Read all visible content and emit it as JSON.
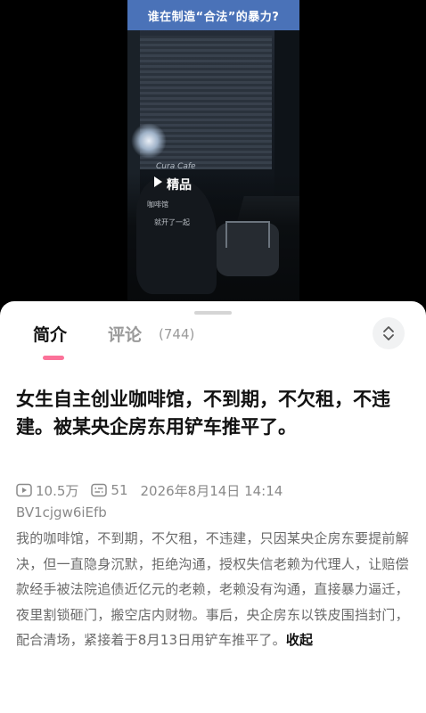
{
  "video": {
    "banner_text": "谁在制造“合法”的暴力?",
    "overlay_sign": "Cura Cafe",
    "overlay_main": "精品",
    "overlay_sub1": "咖啡馆",
    "overlay_sub2": "就开了一起",
    "banner_color": "#4a72b8"
  },
  "tabs": {
    "intro_label": "简介",
    "comments_label": "评论",
    "comments_count": "(744)",
    "accent": "#fb7299",
    "collapse_icon": "chevron-up-down-icon"
  },
  "content": {
    "title": "女生自主创业咖啡馆，不到期，不欠租，不违建。被某央企房东用铲车推平了。",
    "views": "10.5万",
    "danmaku": "51",
    "date": "2026年8月14日 14:14",
    "bvid": "BV1cjgw6iEfb",
    "description": "我的咖啡馆，不到期，不欠租，不违建，只因某央企房东要提前解决，但一直隐身沉默，拒绝沟通，授权失信老赖为代理人，让赔偿款经手被法院追债近亿元的老赖，老赖没有沟通，直接暴力逼迁，夜里割锁砸门，搬空店内财物。事后，央企房东以铁皮围挡封门，配合清场，紧接着于8月13日用铲车推平了。",
    "fold_label": "收起"
  }
}
